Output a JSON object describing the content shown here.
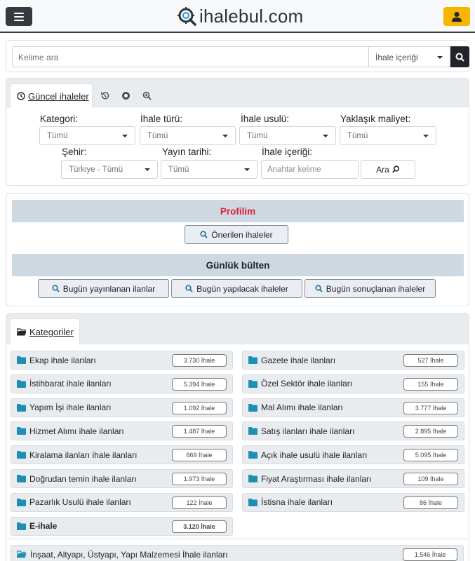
{
  "header": {
    "brand": "ihalebul.com",
    "brand_color": "#2f3136",
    "accent": "#f7b500"
  },
  "search": {
    "placeholder": "Kelime ara",
    "scope": "İhale içeriği"
  },
  "guncel": {
    "tab_label": "Güncel ihaleler",
    "filters": {
      "kategori_label": "Kategori:",
      "kategori_value": "Tümü",
      "ihale_turu_label": "İhale türü:",
      "ihale_turu_value": "Tümü",
      "ihale_usulu_label": "İhale usulü:",
      "ihale_usulu_value": "Tümü",
      "maliyet_label": "Yaklaşık maliyet:",
      "maliyet_value": "Tümü",
      "sehir_label": "Şehir:",
      "sehir_value": "Türkiye - Tümü",
      "yayin_label": "Yayın tarihi:",
      "yayin_value": "Tümü",
      "icerik_label": "İhale içeriği:",
      "icerik_placeholder": "Anahtar kelime",
      "ara_label": "Ara"
    }
  },
  "profil": {
    "title": "Profilim",
    "title_color": "#e0223b",
    "onerilen_label": "Önerilen ihaleler",
    "bulten_title": "Günlük bülten",
    "bugun_yayin": "Bugün yayınlanan ilanlar",
    "bugun_yapilacak": "Bugün yapılacak ihaleler",
    "bugun_sonuc": "Bugün sonuçlanan ihaleler"
  },
  "kategoriler": {
    "tab_label": "Kategoriler",
    "left": [
      {
        "label": "Ekap ihale ilanları",
        "count": "3.730 İhale"
      },
      {
        "label": "İstihbarat ihale ilanları",
        "count": "5.394 İhale"
      },
      {
        "label": "Yapım İşi ihale ilanları",
        "count": "1.092 İhale"
      },
      {
        "label": "Hizmet Alımı ihale ilanları",
        "count": "1.487 İhale"
      },
      {
        "label": "Kiralama ilanları ihale ilanları",
        "count": "669 İhale"
      },
      {
        "label": "Doğrudan temin ihale ilanları",
        "count": "1.973 İhale"
      },
      {
        "label": "Pazarlık Usulü ihale ilanları",
        "count": "122 İhale"
      },
      {
        "label": "E-ihale",
        "count": "3.120 İhale"
      }
    ],
    "right": [
      {
        "label": "Gazete ihale ilanları",
        "count": "527 İhale"
      },
      {
        "label": "Özel Sektör ihale ilanları",
        "count": "155 İhale"
      },
      {
        "label": "Mal Alımı ihale ilanları",
        "count": "3.777 İhale"
      },
      {
        "label": "Satış ilanları ihale ilanları",
        "count": "2.895 İhale"
      },
      {
        "label": "Açık ihale usulü ihale ilanları",
        "count": "5.095 İhale"
      },
      {
        "label": "Fiyat Araştırması ihale ilanları",
        "count": "109 İhale"
      },
      {
        "label": "İstisna ihale ilanları",
        "count": "86 İhale"
      }
    ],
    "extra": {
      "label": "İnşaat, Altyapı, Üstyapı, Yapı Malzemesi İhale ilanları",
      "count": "1.546 İhale"
    }
  },
  "colors": {
    "folder": "#1e8fb3",
    "search_icon": "#1f6f9c"
  }
}
